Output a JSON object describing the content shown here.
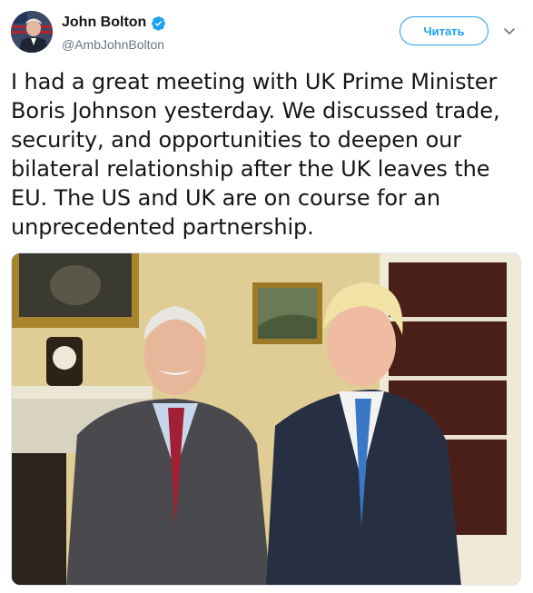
{
  "author": {
    "display_name": "John Bolton",
    "handle": "@AmbJohnBolton",
    "verified_icon": "verified-badge-icon"
  },
  "actions": {
    "follow_label": "Читать",
    "menu_icon": "chevron-down-icon"
  },
  "tweet": {
    "text": "I had a great meeting with UK Prime Minister Boris Johnson yesterday. We discussed trade, security, and opportunities to deepen our bilateral relationship after the UK leaves the EU. The US and UK are on course for an unprecedented partnership."
  },
  "colors": {
    "accent": "#1da1f2",
    "text": "#14171a",
    "secondary": "#657786"
  }
}
